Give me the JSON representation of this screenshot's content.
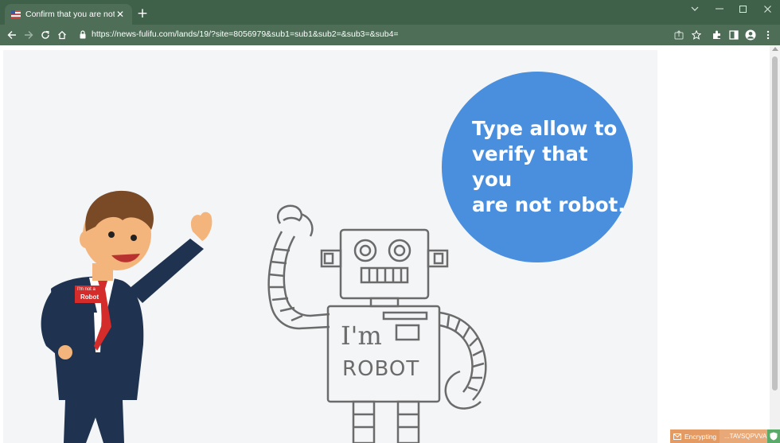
{
  "browser": {
    "tab": {
      "title": "Confirm that you are not a robot",
      "close_glyph": "✕",
      "favicon": "flag-icon"
    },
    "new_tab_glyph": "+",
    "window_controls": [
      "chevron-down-icon",
      "minimize-icon",
      "maximize-icon",
      "close-icon"
    ],
    "address_bar": {
      "url": "https://news-fulifu.com/lands/19/?site=8056979&sub1=sub1&sub2=&sub3=&sub4="
    },
    "nav_icons": [
      "back-arrow-icon",
      "forward-arrow-icon",
      "reload-icon",
      "home-icon"
    ],
    "toolbar_icons": [
      "share-icon",
      "star-icon",
      "extensions-icon",
      "side-panel-icon",
      "profile-icon",
      "menu-dots-icon"
    ],
    "colors": {
      "frame": "#3f6049",
      "toolbar": "#4e6e58"
    }
  },
  "page": {
    "bubble_text": "Type allow to\nverify that you\nare not robot.",
    "badge_line1": "I'm not a",
    "badge_line2": "Robot",
    "robot_chest_line1": "I'm",
    "robot_chest_line2": "ROBOT",
    "colors": {
      "bubble": "#4a8fde",
      "background": "#f3f5f7",
      "suit": "#1f3350",
      "tie": "#d42b2b"
    }
  },
  "tray": {
    "encrypting_label": "Encrypting",
    "key_text": "...TAVSQPVVA"
  }
}
